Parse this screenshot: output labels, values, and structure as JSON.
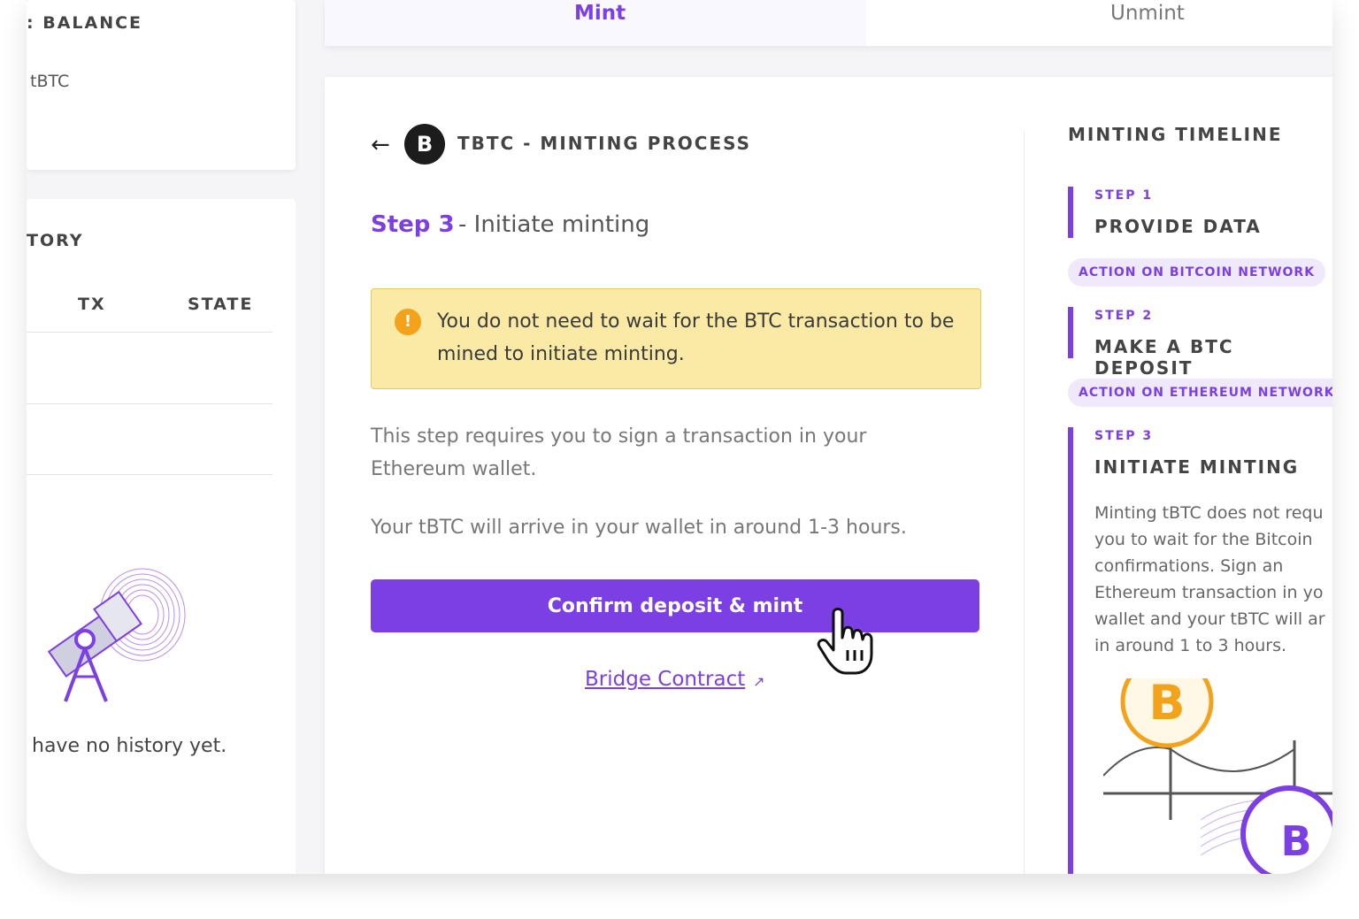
{
  "left_panel": {
    "balance_title": ": BALANCE",
    "balance_unit": "tBTC",
    "history_title": "TORY",
    "history_columns": [
      "TX",
      "STATE"
    ],
    "empty_message": "have no history yet."
  },
  "tabs": {
    "mint": "Mint",
    "unmint": "Unmint"
  },
  "process": {
    "back_icon": "arrow-left-icon",
    "logo_text": "B",
    "title": "TBTC - MINTING PROCESS",
    "step_label": "Step 3",
    "step_name": "- Initiate minting",
    "alert_icon": "!",
    "alert_text": "You do not need to wait for the BTC transaction to be mined to initiate minting.",
    "description_1": "This step requires you to sign a transaction in your Ethereum wallet.",
    "description_2": "Your tBTC will arrive in your wallet in around 1-3 hours.",
    "confirm_button": "Confirm deposit & mint",
    "bridge_link": "Bridge Contract",
    "bridge_link_icon": "↗"
  },
  "timeline": {
    "title": "MINTING TIMELINE",
    "steps": [
      {
        "label": "STEP 1",
        "name": "PROVIDE DATA"
      },
      {
        "label": "STEP 2",
        "name": "MAKE A BTC DEPOSIT"
      },
      {
        "label": "STEP 3",
        "name": "INITIATE MINTING"
      }
    ],
    "badges": [
      "ACTION ON BITCOIN NETWORK",
      "ACTION ON ETHEREUM NETWORK"
    ],
    "step3_description": "Minting tBTC does not requ you to wait for the Bitcoin confirmations. Sign an Ethereum transaction in yo wallet and your tBTC will ar in around 1 to 3 hours."
  },
  "colors": {
    "accent": "#7b3fe4",
    "alert_bg": "#fbeaa6",
    "bitcoin": "#f2a21b"
  }
}
